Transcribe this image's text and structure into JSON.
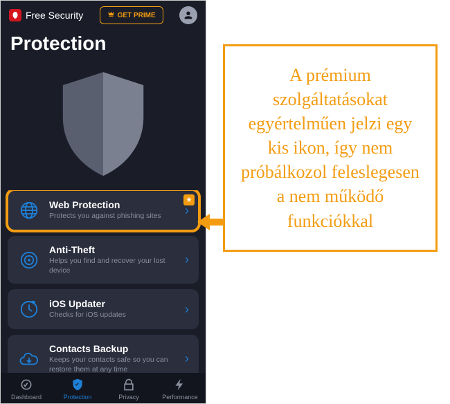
{
  "header": {
    "brand_name": "Free Security",
    "prime_label": "GET PRIME"
  },
  "page_title": "Protection",
  "cards": [
    {
      "title": "Web Protection",
      "subtitle": "Protects you against phishing sites",
      "premium": true,
      "highlighted": true,
      "icon": "globe"
    },
    {
      "title": "Anti-Theft",
      "subtitle": "Helps you find and recover your lost device",
      "premium": false,
      "highlighted": false,
      "icon": "target"
    },
    {
      "title": "iOS Updater",
      "subtitle": "Checks for iOS updates",
      "premium": false,
      "highlighted": false,
      "icon": "refresh"
    },
    {
      "title": "Contacts Backup",
      "subtitle": "Keeps your contacts safe so you can restore them at any time",
      "premium": false,
      "highlighted": false,
      "icon": "cloud"
    }
  ],
  "tabs": [
    {
      "label": "Dashboard",
      "active": false
    },
    {
      "label": "Protection",
      "active": true
    },
    {
      "label": "Privacy",
      "active": false
    },
    {
      "label": "Performance",
      "active": false
    }
  ],
  "callout": {
    "text": "A prémium szolgáltatásokat egyértelműen jelzi egy kis ikon, így nem próbálkozol feleslegesen a nem működő funkciókkal"
  },
  "colors": {
    "accent_orange": "#f39c12",
    "accent_blue": "#1e7fd6",
    "brand_red": "#d4171e",
    "bg_dark": "#1a1d28",
    "card_bg": "#2a2e3d"
  }
}
